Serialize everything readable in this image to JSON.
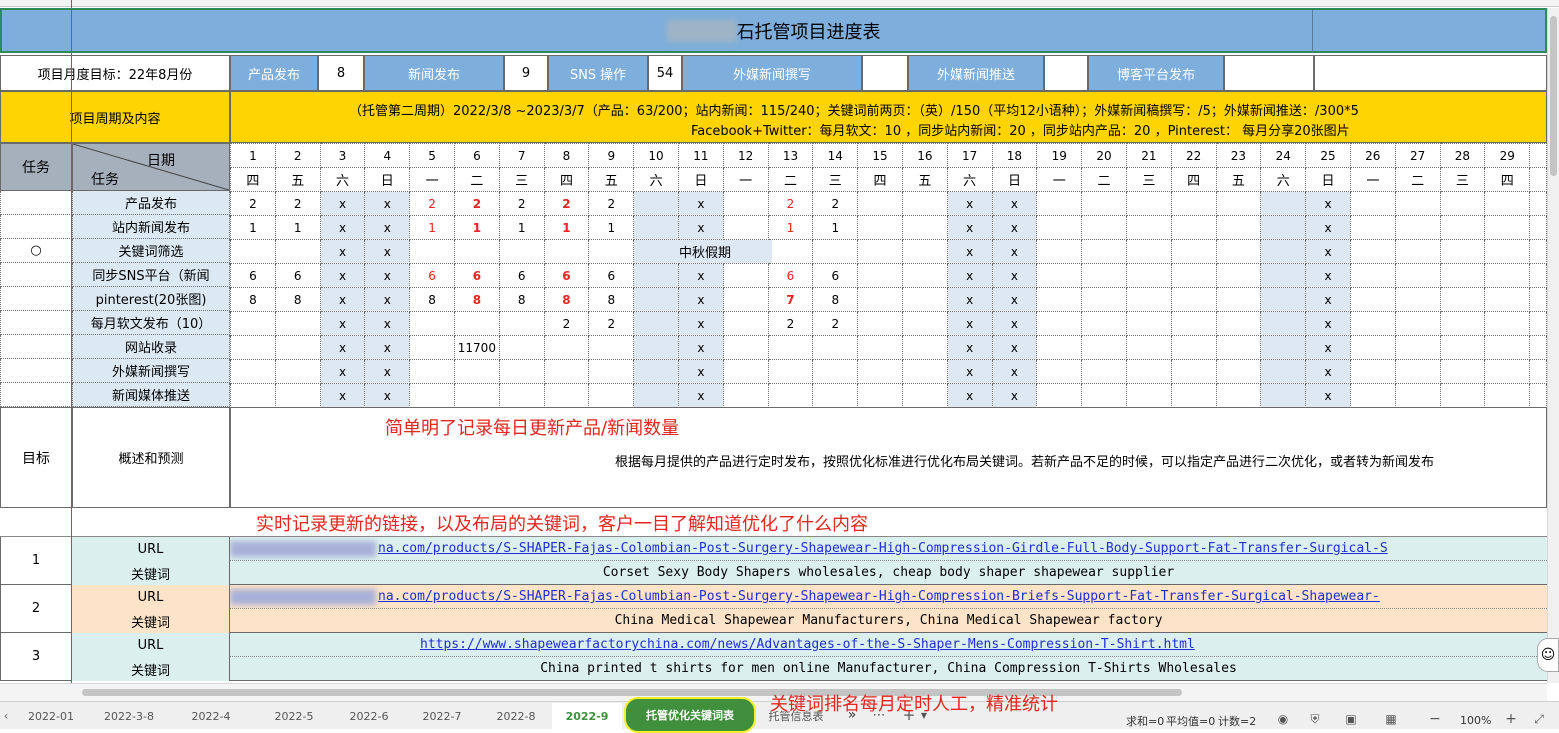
{
  "title": "石托管项目进度表",
  "target_row": {
    "label": "项目月度目标：22年8月份",
    "items": [
      {
        "label": "产品发布",
        "value": "8"
      },
      {
        "label": "新闻发布",
        "value": "9"
      },
      {
        "label": "SNS 操作",
        "value": "54"
      },
      {
        "label": "外媒新闻撰写",
        "value": ""
      },
      {
        "label": "外媒新闻推送",
        "value": ""
      },
      {
        "label": "博客平台发布",
        "value": ""
      }
    ]
  },
  "period": {
    "label": "项目周期及内容",
    "line1": "（托管第二周期）2022/3/8 ~2023/3/7（产品：63/200；站内新闻：115/240；关键词前两页：（英）/150（平均12小语种）；外媒新闻稿撰写：/5；外媒新闻推送：/300*5",
    "line2": "Facebook+Twitter：每月软文：10 ，同步站内新闻：20 ，同步站内产品：20 ，Pinterest： 每月分享20张图片"
  },
  "schedule": {
    "task_header": "任务",
    "date_header": "日期",
    "task_sub_header": "任务",
    "days": [
      "1",
      "2",
      "3",
      "4",
      "5",
      "6",
      "7",
      "8",
      "9",
      "10",
      "11",
      "12",
      "13",
      "14",
      "15",
      "16",
      "17",
      "18",
      "19",
      "20",
      "21",
      "22",
      "23",
      "24",
      "25",
      "26",
      "27",
      "28",
      "29"
    ],
    "weekdays": [
      "四",
      "五",
      "六",
      "日",
      "一",
      "二",
      "三",
      "四",
      "五",
      "六",
      "日",
      "一",
      "二",
      "三",
      "四",
      "五",
      "六",
      "日",
      "一",
      "二",
      "三",
      "四",
      "五",
      "六",
      "日",
      "一",
      "二",
      "三",
      "四"
    ],
    "rows": [
      {
        "mark": "",
        "task": "产品发布",
        "cells": [
          "2",
          "2",
          "x",
          "x",
          "2",
          "2",
          "2",
          "2",
          "2",
          "",
          "x",
          "",
          "2",
          "2",
          "",
          "",
          "x",
          "x",
          "",
          "",
          "",
          "",
          "",
          "",
          "x",
          "",
          "",
          "",
          ""
        ]
      },
      {
        "mark": "",
        "task": "站内新闻发布",
        "cells": [
          "1",
          "1",
          "x",
          "x",
          "1",
          "1",
          "1",
          "1",
          "1",
          "",
          "x",
          "",
          "1",
          "1",
          "",
          "",
          "x",
          "x",
          "",
          "",
          "",
          "",
          "",
          "",
          "x",
          "",
          "",
          "",
          ""
        ]
      },
      {
        "mark": "○",
        "task": "关键词筛选",
        "cells": [
          "",
          "",
          "x",
          "x",
          "",
          "",
          "",
          "",
          "",
          "",
          "",
          "",
          "",
          "",
          "",
          "",
          "x",
          "x",
          "",
          "",
          "",
          "",
          "",
          "",
          "x",
          "",
          "",
          "",
          ""
        ]
      },
      {
        "mark": "",
        "task": "同步SNS平台（新闻",
        "cells": [
          "6",
          "6",
          "x",
          "x",
          "6",
          "6",
          "6",
          "6",
          "6",
          "",
          "x",
          "",
          "6",
          "6",
          "",
          "",
          "x",
          "x",
          "",
          "",
          "",
          "",
          "",
          "",
          "x",
          "",
          "",
          "",
          ""
        ]
      },
      {
        "mark": "",
        "task": "pinterest(20张图)",
        "cells": [
          "8",
          "8",
          "x",
          "x",
          "8",
          "8",
          "8",
          "8",
          "8",
          "",
          "x",
          "",
          "7",
          "8",
          "",
          "",
          "x",
          "x",
          "",
          "",
          "",
          "",
          "",
          "",
          "x",
          "",
          "",
          "",
          ""
        ]
      },
      {
        "mark": "",
        "task": "每月软文发布（10）",
        "cells": [
          "",
          "",
          "x",
          "x",
          "",
          "",
          "",
          "2",
          "2",
          "",
          "x",
          "",
          "2",
          "2",
          "",
          "",
          "x",
          "x",
          "",
          "",
          "",
          "",
          "",
          "",
          "x",
          "",
          "",
          "",
          ""
        ]
      },
      {
        "mark": "",
        "task": "网站收录",
        "cells": [
          "",
          "",
          "x",
          "x",
          "",
          "11700",
          "",
          "",
          "",
          "",
          "x",
          "",
          "",
          "",
          "",
          "",
          "x",
          "x",
          "",
          "",
          "",
          "",
          "",
          "",
          "x",
          "",
          "",
          "",
          ""
        ]
      },
      {
        "mark": "",
        "task": "外媒新闻撰写",
        "cells": [
          "",
          "",
          "x",
          "x",
          "",
          "",
          "",
          "",
          "",
          "",
          "x",
          "",
          "",
          "",
          "",
          "",
          "x",
          "x",
          "",
          "",
          "",
          "",
          "",
          "",
          "x",
          "",
          "",
          "",
          ""
        ]
      },
      {
        "mark": "",
        "task": "新闻媒体推送",
        "cells": [
          "",
          "",
          "x",
          "x",
          "",
          "",
          "",
          "",
          "",
          "",
          "x",
          "",
          "",
          "",
          "",
          "",
          "x",
          "x",
          "",
          "",
          "",
          "",
          "",
          "",
          "x",
          "",
          "",
          "",
          ""
        ]
      }
    ],
    "holiday": "中秋假期"
  },
  "goal": {
    "label": "目标",
    "sub": "概述和预测",
    "annotation": "简单明了记录每日更新产品/新闻数量",
    "text": "根据每月提供的产品进行定时发布，按照优化标准进行优化布局关键词。若新产品不足的时候，可以指定产品进行二次优化，或者转为新闻发布"
  },
  "annotation2": "实时记录更新的链接，以及布局的关键词，客户一目了解知道优化了什么内容",
  "url_rows": [
    {
      "num": "1",
      "url_label": "URL",
      "kw_label": "关键词",
      "url": "na.com/products/S-SHAPER-Fajas-Colombian-Post-Surgery-Shapewear-High-Compression-Girdle-Full-Body-Support-Fat-Transfer-Surgical-S",
      "keywords": "Corset Sexy Body Shapers wholesales, cheap body shaper shapewear supplier"
    },
    {
      "num": "2",
      "url_label": "URL",
      "kw_label": "关键词",
      "url": "na.com/products/S-SHAPER-Fajas-Columbian-Post-Surgery-Shapewear-High-Compression-Briefs-Support-Fat-Transfer-Surgical-Shapewear-",
      "keywords": "China Medical Shapewear Manufacturers, China Medical Shapewear factory"
    },
    {
      "num": "3",
      "url_label": "URL",
      "kw_label": "关键词",
      "url": "https://www.shapewearfactorychina.com/news/Advantages-of-the-S-Shaper-Mens-Compression-T-Shirt.html",
      "keywords": "China printed t shirts for men online Manufacturer, China Compression T-Shirts Wholesales"
    }
  ],
  "sheet_tabs": [
    "2022-01",
    "2022-3-8",
    "2022-4",
    "2022-5",
    "2022-6",
    "2022-7",
    "2022-8",
    "2022-9",
    "托管优化关键词表",
    "托管信息表"
  ],
  "active_tab": "2022-9",
  "highlighted_tab": "托管优化关键词表",
  "annotation3": "关键词排名每月定时人工，精准统计",
  "status": {
    "sum": "求和=0",
    "avg": "平均值=0",
    "count": "计数=2",
    "zoom": "100%"
  },
  "colors": {
    "title_bg": "#7eaedb",
    "blue_cell": "#7eaedb",
    "yellow": "#ffd400",
    "gray_header": "#a6b0bd",
    "task_bg": "#dce9f3",
    "weekend": "#dde8f3",
    "red": "#e5261f",
    "link": "#1f2fd3",
    "green_tab": "#3f8f3c"
  }
}
